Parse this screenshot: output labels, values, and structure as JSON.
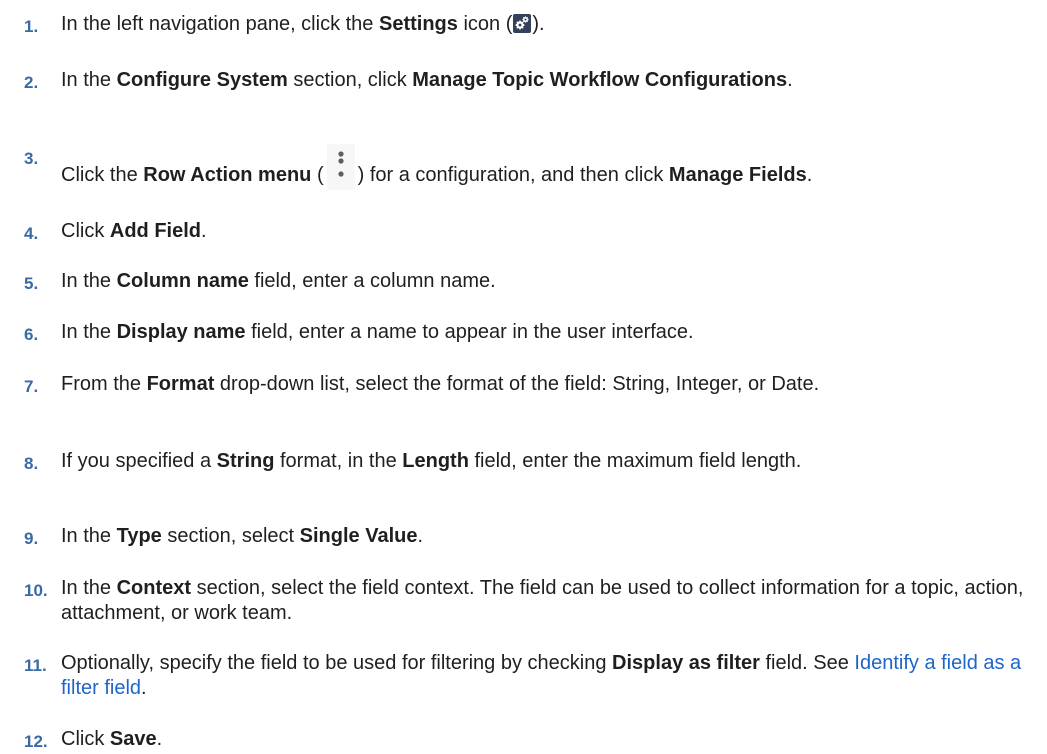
{
  "steps": [
    {
      "number": "1.",
      "parts": [
        {
          "t": "In the left navigation pane, click the "
        },
        {
          "t": "Settings",
          "b": true
        },
        {
          "t": " icon ("
        },
        {
          "icon": "settings-icon"
        },
        {
          "t": ")."
        }
      ]
    },
    {
      "number": "2.",
      "parts": [
        {
          "t": "In the "
        },
        {
          "t": "Configure System",
          "b": true
        },
        {
          "t": " section, click "
        },
        {
          "t": "Manage Topic Workflow Configurations",
          "b": true
        },
        {
          "t": "."
        }
      ]
    },
    {
      "number": "3.",
      "parts": [
        {
          "t": "Click the "
        },
        {
          "t": "Row Action menu",
          "b": true
        },
        {
          "t": " ("
        },
        {
          "icon": "kebab-menu-icon"
        },
        {
          "t": ") for a configuration, and then click "
        },
        {
          "t": "Manage Fields",
          "b": true
        },
        {
          "t": "."
        }
      ]
    },
    {
      "number": "4.",
      "parts": [
        {
          "t": "Click "
        },
        {
          "t": "Add Field",
          "b": true
        },
        {
          "t": "."
        }
      ]
    },
    {
      "number": "5.",
      "parts": [
        {
          "t": "In the "
        },
        {
          "t": "Column name",
          "b": true
        },
        {
          "t": " field, enter a column name."
        }
      ]
    },
    {
      "number": "6.",
      "parts": [
        {
          "t": "In the "
        },
        {
          "t": "Display name",
          "b": true
        },
        {
          "t": " field, enter a name to appear in the user interface."
        }
      ]
    },
    {
      "number": "7.",
      "parts": [
        {
          "t": "From the "
        },
        {
          "t": "Format",
          "b": true
        },
        {
          "t": " drop-down list, select the format of the field: String, Integer, or Date."
        }
      ]
    },
    {
      "number": "8.",
      "parts": [
        {
          "t": "If you specified a "
        },
        {
          "t": "String",
          "b": true
        },
        {
          "t": " format, in the "
        },
        {
          "t": "Length",
          "b": true
        },
        {
          "t": " field, enter the maximum field length."
        }
      ]
    },
    {
      "number": "9.",
      "parts": [
        {
          "t": "In the "
        },
        {
          "t": "Type",
          "b": true
        },
        {
          "t": " section, select "
        },
        {
          "t": "Single Value",
          "b": true
        },
        {
          "t": "."
        }
      ]
    },
    {
      "number": "10.",
      "parts": [
        {
          "t": "In the "
        },
        {
          "t": "Context",
          "b": true
        },
        {
          "t": " section, select the field context. The field can be used to collect information for a topic, action, attachment, or work team."
        }
      ]
    },
    {
      "number": "11.",
      "parts": [
        {
          "t": "Optionally, specify the field to be used for filtering by checking "
        },
        {
          "t": "Display as filter",
          "b": true
        },
        {
          "t": " field. See "
        },
        {
          "t": "Identify a field as a filter field",
          "link": true
        },
        {
          "t": "."
        }
      ]
    },
    {
      "number": "12.",
      "parts": [
        {
          "t": "Click "
        },
        {
          "t": "Save",
          "b": true
        },
        {
          "t": "."
        }
      ]
    }
  ],
  "colors": {
    "step_number": "#3a6aa6",
    "link": "#1f65c8",
    "text": "#1f1f1f"
  }
}
